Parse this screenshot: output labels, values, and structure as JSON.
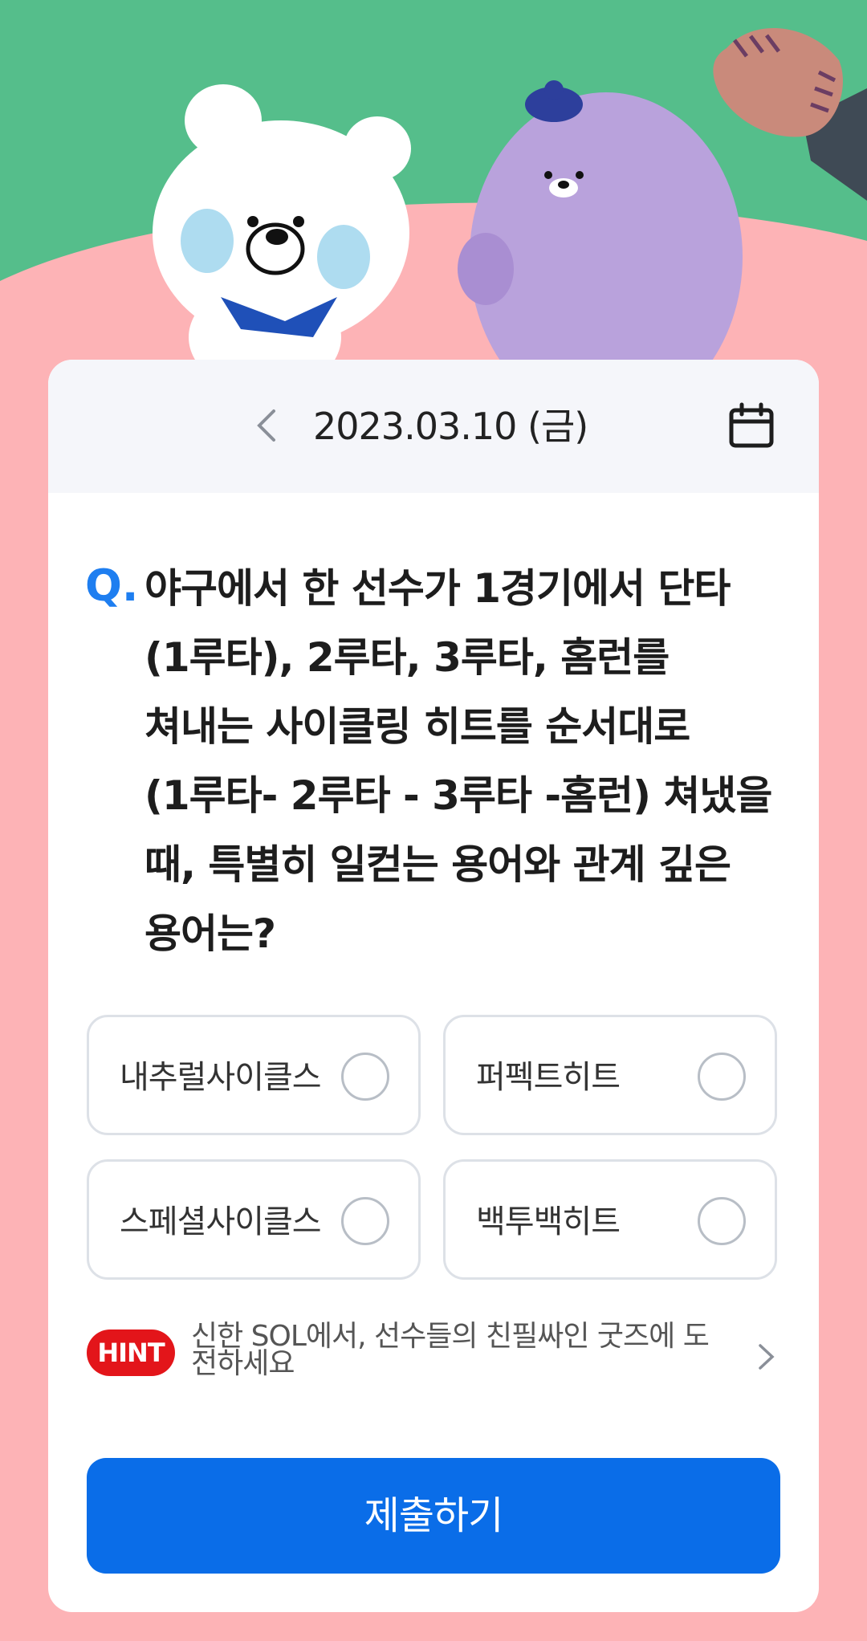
{
  "scene": {
    "background_top_color": "#55be8b",
    "background_bottom_color": "#fdb3b6"
  },
  "date_bar": {
    "prev_icon": "chevron-left-icon",
    "date": "2023.03.10 (금)",
    "calendar_icon": "calendar-icon"
  },
  "quiz": {
    "q_mark": "Q.",
    "question": "야구에서 한 선수가 1경기에서 단타(1루타), 2루타, 3루타, 홈런를 쳐내는 사이클링 히트를 순서대로(1루타- 2루타 - 3루타 -홈런) 쳐냈을 때, 특별히 일컫는 용어와 관계 깊은 용어는?",
    "options": [
      {
        "label": "내추럴사이클스"
      },
      {
        "label": "퍼펙트히트"
      },
      {
        "label": "스페셜사이클스"
      },
      {
        "label": "백투백히트"
      }
    ]
  },
  "hint": {
    "badge": "HINT",
    "text": "신한 SOL에서, 선수들의 친필싸인 굿즈에 도전하세요",
    "arrow_icon": "chevron-right-icon"
  },
  "submit": {
    "label": "제출하기",
    "color": "#0a6de8"
  }
}
